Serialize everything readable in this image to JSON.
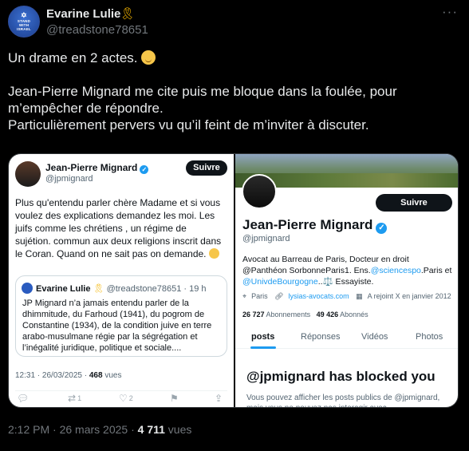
{
  "author": {
    "name": "Evarine Lulie",
    "badge_emoji": "🎗",
    "handle": "@treadstone78651",
    "avatar_text": [
      "STAND",
      "WITH",
      "ISRAEL"
    ]
  },
  "tweet": {
    "line1": "Un drame en 2 actes. ",
    "line2": "Jean-Pierre Mignard me cite puis me bloque dans la foulée, pour m’empêcher de répondre.",
    "line3": "Particulièrement pervers vu qu’il feint de m’inviter à discuter."
  },
  "left_panel": {
    "name": "Jean-Pierre Mignard",
    "handle": "@jpmignard",
    "follow_label": "Suivre",
    "body": "Plus qu'entendu parler chère Madame et si vous voulez des explications  demandez les moi. Les juifs comme les chrétiens , un régime de sujétion. commun aux deux religions inscrit dans le Coran. Quand on ne sait pas on demande.",
    "quote": {
      "name": "Evarine Lulie",
      "ribbon": "🎗",
      "meta": "@treadstone78651 · 19 h",
      "body": "JP Mignard n’a jamais entendu parler de la dhimmitude, du Farhoud (1941), du pogrom de Constantine (1934), de la condition juive en terre arabo-musulmane régie par la ségrégation et l’inégalité juridique, politique et sociale...."
    },
    "timestamp": "12:31 · 26/03/2025 · ",
    "views_count": "468",
    "views_label": " vues",
    "retweet_count": "1",
    "like_count": "2"
  },
  "right_panel": {
    "follow_label": "Suivre",
    "name": "Jean-Pierre Mignard",
    "handle": "@jpmignard",
    "bio_1": "Avocat au Barreau de Paris, Docteur en droit @Panthéon SorbonneParis1. Ens.",
    "bio_link1": "@sciencespo",
    "bio_2": ".Paris et ",
    "bio_link2": "@UnivdeBourgogne",
    "bio_3": "..⚖️ Essayiste.",
    "location": "Paris",
    "website": "lysias-avocats.com",
    "joined": "A rejoint X en janvier 2012",
    "following_count": "26 727",
    "following_label": " Abonnements",
    "followers_count": "49 426",
    "followers_label": " Abonnés",
    "tabs": [
      "posts",
      "Réponses",
      "Vidéos",
      "Photos"
    ],
    "blocked_title": "@jpmignard has blocked you",
    "blocked_text": "Vous pouvez afficher les posts publics de @jpmignard, mais vous ne pouvez pas interagir avec"
  },
  "footer": {
    "time": "2:12 PM · 26 mars 2025 · ",
    "views_count": "4 711",
    "views_label": " vues"
  },
  "colors": {
    "background": "#000000",
    "text": "#e7e9ea",
    "muted": "#71767b",
    "accent": "#1d9bf0"
  }
}
